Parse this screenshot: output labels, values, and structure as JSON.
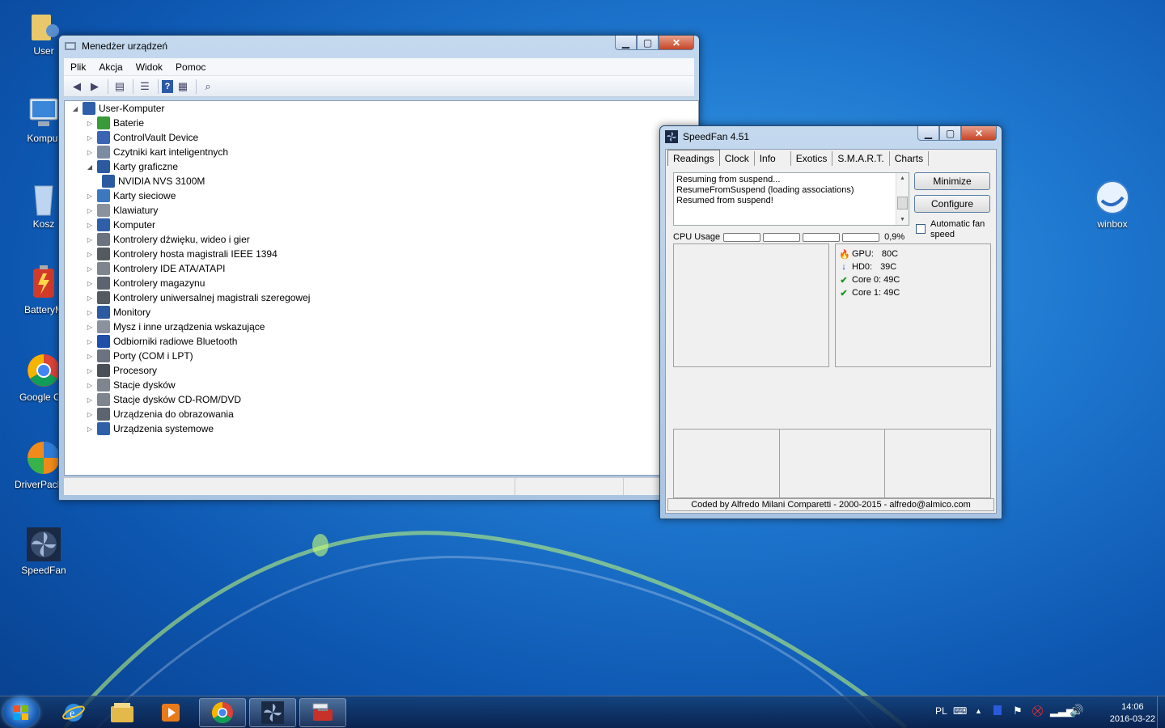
{
  "desktop": {
    "icons": [
      {
        "label": "User"
      },
      {
        "label": "Komput"
      },
      {
        "label": "Kosz"
      },
      {
        "label": "BatteryM"
      },
      {
        "label": "Google Chi"
      },
      {
        "label": "DriverPack-O"
      },
      {
        "label": "SpeedFan"
      },
      {
        "label": "winbox"
      }
    ]
  },
  "devmgr": {
    "title": "Menedżer urządzeń",
    "menu": [
      "Plik",
      "Akcja",
      "Widok",
      "Pomoc"
    ],
    "root": "User-Komputer",
    "nodes": [
      {
        "label": "Baterie",
        "icon": "battery-icon",
        "color": "#3a9a3a"
      },
      {
        "label": "ControlVault Device",
        "icon": "device-icon",
        "color": "#3c64b4"
      },
      {
        "label": "Czytniki kart inteligentnych",
        "icon": "card-reader-icon",
        "color": "#7b8ca2"
      },
      {
        "label": "Karty graficzne",
        "icon": "display-adapter-icon",
        "color": "#2c5aa0"
      },
      {
        "label": "NVIDIA NVS 3100M",
        "icon": "display-adapter-icon",
        "color": "#2c5aa0"
      },
      {
        "label": "Karty sieciowe",
        "icon": "network-icon",
        "color": "#3c78c0"
      },
      {
        "label": "Klawiatury",
        "icon": "keyboard-icon",
        "color": "#8a939d"
      },
      {
        "label": "Komputer",
        "icon": "computer-icon",
        "color": "#2f5fa8"
      },
      {
        "label": "Kontrolery dźwięku, wideo i gier",
        "icon": "speaker-icon",
        "color": "#6b7380"
      },
      {
        "label": "Kontrolery hosta magistrali IEEE 1394",
        "icon": "firewire-icon",
        "color": "#555a62"
      },
      {
        "label": "Kontrolery IDE ATA/ATAPI",
        "icon": "ide-icon",
        "color": "#7e858e"
      },
      {
        "label": "Kontrolery magazynu",
        "icon": "storage-icon",
        "color": "#5c6470"
      },
      {
        "label": "Kontrolery uniwersalnej magistrali szeregowej",
        "icon": "usb-icon",
        "color": "#555a62"
      },
      {
        "label": "Monitory",
        "icon": "monitor-icon",
        "color": "#2c5aa0"
      },
      {
        "label": "Mysz i inne urządzenia wskazujące",
        "icon": "mouse-icon",
        "color": "#8a939d"
      },
      {
        "label": "Odbiorniki radiowe Bluetooth",
        "icon": "bluetooth-icon",
        "color": "#1f4fa8"
      },
      {
        "label": "Porty (COM i LPT)",
        "icon": "port-icon",
        "color": "#6b7380"
      },
      {
        "label": "Procesory",
        "icon": "cpu-icon",
        "color": "#4a4f57"
      },
      {
        "label": "Stacje dysków",
        "icon": "disk-icon",
        "color": "#7e858e"
      },
      {
        "label": "Stacje dysków CD-ROM/DVD",
        "icon": "cdrom-icon",
        "color": "#7e858e"
      },
      {
        "label": "Urządzenia do obrazowania",
        "icon": "camera-icon",
        "color": "#5c6470"
      },
      {
        "label": "Urządzenia systemowe",
        "icon": "system-icon",
        "color": "#2f5fa8"
      }
    ]
  },
  "speedfan": {
    "title": "SpeedFan 4.51",
    "tabs": [
      "Readings",
      "Clock",
      "Info",
      "Exotics",
      "S.M.A.R.T.",
      "Charts"
    ],
    "log": [
      "Resuming from suspend...",
      "ResumeFromSuspend (loading associations)",
      "Resumed from suspend!"
    ],
    "buttons": {
      "minimize": "Minimize",
      "configure": "Configure"
    },
    "auto_fan_label_1": "Automatic fan",
    "auto_fan_label_2": "speed",
    "cpu_usage_label": "CPU Usage",
    "cpu_usage_value": "0,9%",
    "readings": [
      {
        "name": "GPU:",
        "value": "80C",
        "icon": "flame-icon",
        "symbol": "🔥",
        "color": "#d23a1a"
      },
      {
        "name": "HD0:",
        "value": "39C",
        "icon": "arrow-down-icon",
        "symbol": "↓",
        "color": "#1f3fb0"
      },
      {
        "name": "Core 0:",
        "value": "49C",
        "icon": "check-icon",
        "symbol": "✔",
        "color": "#1a9a1a"
      },
      {
        "name": "Core 1:",
        "value": "49C",
        "icon": "check-icon",
        "symbol": "✔",
        "color": "#1a9a1a"
      }
    ],
    "footer": "Coded by Alfredo Milani Comparetti - 2000-2015 - alfredo@almico.com"
  },
  "taskbar": {
    "language": "PL",
    "time": "14:06",
    "date": "2016-03-22"
  }
}
